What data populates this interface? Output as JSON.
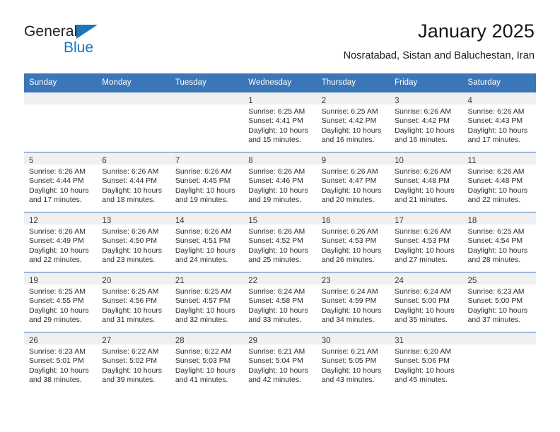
{
  "brand": {
    "line1": "General",
    "line2": "Blue",
    "triangle_color": "#1b75bb"
  },
  "header": {
    "title": "January 2025",
    "subtitle": "Nosratabad, Sistan and Baluchestan, Iran",
    "header_bg": "#3b77b8",
    "daynum_bg": "#f0f0f0"
  },
  "calendar": {
    "weekday_headers": [
      "Sunday",
      "Monday",
      "Tuesday",
      "Wednesday",
      "Thursday",
      "Friday",
      "Saturday"
    ],
    "weeks": [
      [
        {
          "day": "",
          "empty": true
        },
        {
          "day": "",
          "empty": true
        },
        {
          "day": "",
          "empty": true
        },
        {
          "day": "1",
          "sunrise": "Sunrise: 6:25 AM",
          "sunset": "Sunset: 4:41 PM",
          "daylight1": "Daylight: 10 hours",
          "daylight2": "and 15 minutes."
        },
        {
          "day": "2",
          "sunrise": "Sunrise: 6:25 AM",
          "sunset": "Sunset: 4:42 PM",
          "daylight1": "Daylight: 10 hours",
          "daylight2": "and 16 minutes."
        },
        {
          "day": "3",
          "sunrise": "Sunrise: 6:26 AM",
          "sunset": "Sunset: 4:42 PM",
          "daylight1": "Daylight: 10 hours",
          "daylight2": "and 16 minutes."
        },
        {
          "day": "4",
          "sunrise": "Sunrise: 6:26 AM",
          "sunset": "Sunset: 4:43 PM",
          "daylight1": "Daylight: 10 hours",
          "daylight2": "and 17 minutes."
        }
      ],
      [
        {
          "day": "5",
          "sunrise": "Sunrise: 6:26 AM",
          "sunset": "Sunset: 4:44 PM",
          "daylight1": "Daylight: 10 hours",
          "daylight2": "and 17 minutes."
        },
        {
          "day": "6",
          "sunrise": "Sunrise: 6:26 AM",
          "sunset": "Sunset: 4:44 PM",
          "daylight1": "Daylight: 10 hours",
          "daylight2": "and 18 minutes."
        },
        {
          "day": "7",
          "sunrise": "Sunrise: 6:26 AM",
          "sunset": "Sunset: 4:45 PM",
          "daylight1": "Daylight: 10 hours",
          "daylight2": "and 19 minutes."
        },
        {
          "day": "8",
          "sunrise": "Sunrise: 6:26 AM",
          "sunset": "Sunset: 4:46 PM",
          "daylight1": "Daylight: 10 hours",
          "daylight2": "and 19 minutes."
        },
        {
          "day": "9",
          "sunrise": "Sunrise: 6:26 AM",
          "sunset": "Sunset: 4:47 PM",
          "daylight1": "Daylight: 10 hours",
          "daylight2": "and 20 minutes."
        },
        {
          "day": "10",
          "sunrise": "Sunrise: 6:26 AM",
          "sunset": "Sunset: 4:48 PM",
          "daylight1": "Daylight: 10 hours",
          "daylight2": "and 21 minutes."
        },
        {
          "day": "11",
          "sunrise": "Sunrise: 6:26 AM",
          "sunset": "Sunset: 4:48 PM",
          "daylight1": "Daylight: 10 hours",
          "daylight2": "and 22 minutes."
        }
      ],
      [
        {
          "day": "12",
          "sunrise": "Sunrise: 6:26 AM",
          "sunset": "Sunset: 4:49 PM",
          "daylight1": "Daylight: 10 hours",
          "daylight2": "and 22 minutes."
        },
        {
          "day": "13",
          "sunrise": "Sunrise: 6:26 AM",
          "sunset": "Sunset: 4:50 PM",
          "daylight1": "Daylight: 10 hours",
          "daylight2": "and 23 minutes."
        },
        {
          "day": "14",
          "sunrise": "Sunrise: 6:26 AM",
          "sunset": "Sunset: 4:51 PM",
          "daylight1": "Daylight: 10 hours",
          "daylight2": "and 24 minutes."
        },
        {
          "day": "15",
          "sunrise": "Sunrise: 6:26 AM",
          "sunset": "Sunset: 4:52 PM",
          "daylight1": "Daylight: 10 hours",
          "daylight2": "and 25 minutes."
        },
        {
          "day": "16",
          "sunrise": "Sunrise: 6:26 AM",
          "sunset": "Sunset: 4:53 PM",
          "daylight1": "Daylight: 10 hours",
          "daylight2": "and 26 minutes."
        },
        {
          "day": "17",
          "sunrise": "Sunrise: 6:26 AM",
          "sunset": "Sunset: 4:53 PM",
          "daylight1": "Daylight: 10 hours",
          "daylight2": "and 27 minutes."
        },
        {
          "day": "18",
          "sunrise": "Sunrise: 6:25 AM",
          "sunset": "Sunset: 4:54 PM",
          "daylight1": "Daylight: 10 hours",
          "daylight2": "and 28 minutes."
        }
      ],
      [
        {
          "day": "19",
          "sunrise": "Sunrise: 6:25 AM",
          "sunset": "Sunset: 4:55 PM",
          "daylight1": "Daylight: 10 hours",
          "daylight2": "and 29 minutes."
        },
        {
          "day": "20",
          "sunrise": "Sunrise: 6:25 AM",
          "sunset": "Sunset: 4:56 PM",
          "daylight1": "Daylight: 10 hours",
          "daylight2": "and 31 minutes."
        },
        {
          "day": "21",
          "sunrise": "Sunrise: 6:25 AM",
          "sunset": "Sunset: 4:57 PM",
          "daylight1": "Daylight: 10 hours",
          "daylight2": "and 32 minutes."
        },
        {
          "day": "22",
          "sunrise": "Sunrise: 6:24 AM",
          "sunset": "Sunset: 4:58 PM",
          "daylight1": "Daylight: 10 hours",
          "daylight2": "and 33 minutes."
        },
        {
          "day": "23",
          "sunrise": "Sunrise: 6:24 AM",
          "sunset": "Sunset: 4:59 PM",
          "daylight1": "Daylight: 10 hours",
          "daylight2": "and 34 minutes."
        },
        {
          "day": "24",
          "sunrise": "Sunrise: 6:24 AM",
          "sunset": "Sunset: 5:00 PM",
          "daylight1": "Daylight: 10 hours",
          "daylight2": "and 35 minutes."
        },
        {
          "day": "25",
          "sunrise": "Sunrise: 6:23 AM",
          "sunset": "Sunset: 5:00 PM",
          "daylight1": "Daylight: 10 hours",
          "daylight2": "and 37 minutes."
        }
      ],
      [
        {
          "day": "26",
          "sunrise": "Sunrise: 6:23 AM",
          "sunset": "Sunset: 5:01 PM",
          "daylight1": "Daylight: 10 hours",
          "daylight2": "and 38 minutes."
        },
        {
          "day": "27",
          "sunrise": "Sunrise: 6:22 AM",
          "sunset": "Sunset: 5:02 PM",
          "daylight1": "Daylight: 10 hours",
          "daylight2": "and 39 minutes."
        },
        {
          "day": "28",
          "sunrise": "Sunrise: 6:22 AM",
          "sunset": "Sunset: 5:03 PM",
          "daylight1": "Daylight: 10 hours",
          "daylight2": "and 41 minutes."
        },
        {
          "day": "29",
          "sunrise": "Sunrise: 6:21 AM",
          "sunset": "Sunset: 5:04 PM",
          "daylight1": "Daylight: 10 hours",
          "daylight2": "and 42 minutes."
        },
        {
          "day": "30",
          "sunrise": "Sunrise: 6:21 AM",
          "sunset": "Sunset: 5:05 PM",
          "daylight1": "Daylight: 10 hours",
          "daylight2": "and 43 minutes."
        },
        {
          "day": "31",
          "sunrise": "Sunrise: 6:20 AM",
          "sunset": "Sunset: 5:06 PM",
          "daylight1": "Daylight: 10 hours",
          "daylight2": "and 45 minutes."
        },
        {
          "day": "",
          "empty": true
        }
      ]
    ]
  }
}
